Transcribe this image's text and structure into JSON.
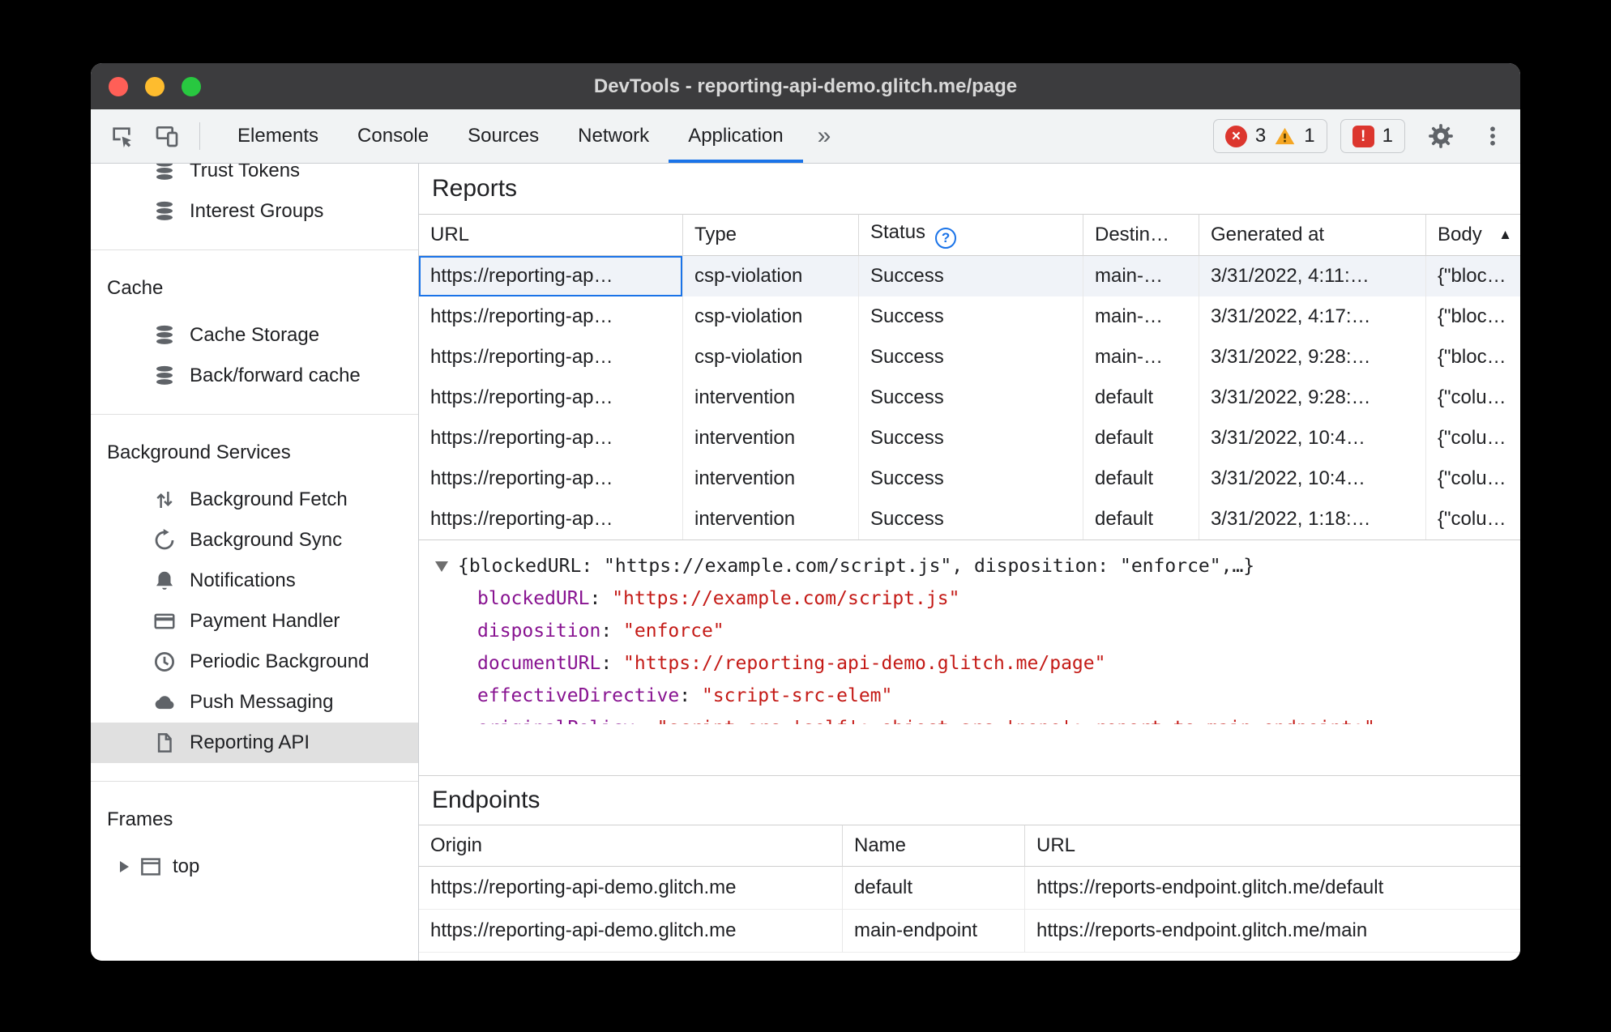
{
  "window": {
    "title": "DevTools - reporting-api-demo.glitch.me/page"
  },
  "icons": {
    "help": "?",
    "sort_ascending": "▲",
    "error_cross": "×",
    "issues_mark": "!"
  },
  "toolbar": {
    "tabs": [
      {
        "label": "Elements",
        "selected": false
      },
      {
        "label": "Console",
        "selected": false
      },
      {
        "label": "Sources",
        "selected": false
      },
      {
        "label": "Network",
        "selected": false
      },
      {
        "label": "Application",
        "selected": true
      }
    ],
    "more_tabs": "»",
    "badges": {
      "errors": "3",
      "warnings": "1",
      "issues": "1"
    }
  },
  "sidebar": {
    "items": [
      {
        "label": "Trust Tokens",
        "icon": "database-icon"
      },
      {
        "label": "Interest Groups",
        "icon": "database-icon"
      },
      {
        "label": "Cache",
        "type": "header"
      },
      {
        "label": "Cache Storage",
        "icon": "database-icon"
      },
      {
        "label": "Back/forward cache",
        "icon": "database-icon"
      },
      {
        "label": "Background Services",
        "type": "header"
      },
      {
        "label": "Background Fetch",
        "icon": "up-down-arrows-icon"
      },
      {
        "label": "Background Sync",
        "icon": "sync-icon"
      },
      {
        "label": "Notifications",
        "icon": "bell-icon"
      },
      {
        "label": "Payment Handler",
        "icon": "credit-card-icon"
      },
      {
        "label": "Periodic Background",
        "icon": "clock-icon"
      },
      {
        "label": "Push Messaging",
        "icon": "cloud-icon"
      },
      {
        "label": "Reporting API",
        "icon": "document-icon",
        "selected": true
      },
      {
        "label": "Frames",
        "type": "header"
      },
      {
        "label": "top",
        "icon": "frame-icon"
      }
    ]
  },
  "reports": {
    "title": "Reports",
    "columns": [
      "URL",
      "Type",
      "Status",
      "Destin…",
      "Generated at",
      "Body"
    ],
    "rows": [
      {
        "url": "https://reporting-ap…",
        "type": "csp-violation",
        "status": "Success",
        "destination": "main-…",
        "generated": "3/31/2022, 4:11:…",
        "body": "{\"bloc…",
        "selected": true
      },
      {
        "url": "https://reporting-ap…",
        "type": "csp-violation",
        "status": "Success",
        "destination": "main-…",
        "generated": "3/31/2022, 4:17:…",
        "body": "{\"bloc…",
        "selected": false
      },
      {
        "url": "https://reporting-ap…",
        "type": "csp-violation",
        "status": "Success",
        "destination": "main-…",
        "generated": "3/31/2022, 9:28:…",
        "body": "{\"bloc…",
        "selected": false
      },
      {
        "url": "https://reporting-ap…",
        "type": "intervention",
        "status": "Success",
        "destination": "default",
        "generated": "3/31/2022, 9:28:…",
        "body": "{\"colu…",
        "selected": false
      },
      {
        "url": "https://reporting-ap…",
        "type": "intervention",
        "status": "Success",
        "destination": "default",
        "generated": "3/31/2022, 10:4…",
        "body": "{\"colu…",
        "selected": false
      },
      {
        "url": "https://reporting-ap…",
        "type": "intervention",
        "status": "Success",
        "destination": "default",
        "generated": "3/31/2022, 10:4…",
        "body": "{\"colu…",
        "selected": false
      },
      {
        "url": "https://reporting-ap…",
        "type": "intervention",
        "status": "Success",
        "destination": "default",
        "generated": "3/31/2022, 1:18:…",
        "body": "{\"colu…",
        "selected": false
      }
    ]
  },
  "preview": {
    "summary": "{blockedURL: \"https://example.com/script.js\", disposition: \"enforce\",…}",
    "separator": ": ",
    "properties": [
      {
        "name": "blockedURL",
        "value": "\"https://example.com/script.js\""
      },
      {
        "name": "disposition",
        "value": "\"enforce\""
      },
      {
        "name": "documentURL",
        "value": "\"https://reporting-api-demo.glitch.me/page\""
      },
      {
        "name": "effectiveDirective",
        "value": "\"script-src-elem\""
      }
    ],
    "clipped": {
      "name": "originalPolicy",
      "value": "\"script-src 'self'; object-src 'none'; report-to main-endpoint;\""
    }
  },
  "endpoints": {
    "title": "Endpoints",
    "columns": [
      "Origin",
      "Name",
      "URL"
    ],
    "rows": [
      {
        "origin": "https://reporting-api-demo.glitch.me",
        "name": "default",
        "url": "https://reports-endpoint.glitch.me/default"
      },
      {
        "origin": "https://reporting-api-demo.glitch.me",
        "name": "main-endpoint",
        "url": "https://reports-endpoint.glitch.me/main"
      }
    ]
  }
}
